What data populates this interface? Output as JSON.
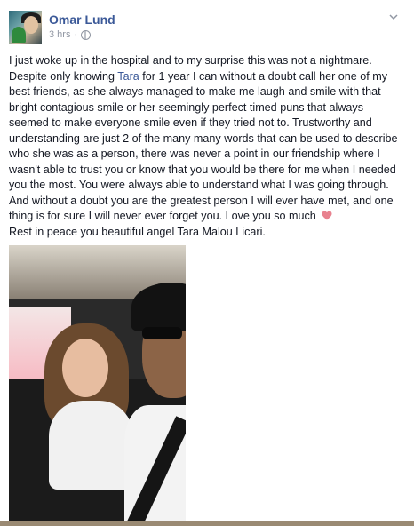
{
  "post": {
    "author_name": "Omar Lund",
    "timestamp": "3 hrs",
    "separator": "·",
    "body_before_link": "I just woke up in the hospital and to my surprise this was not a nightmare. Despite only knowing ",
    "tagged_name": "Tara",
    "body_after_link": " for 1 year I can without a doubt call her one of my best friends, as she always managed to make me laugh and smile with that bright contagious smile or her seemingly perfect timed puns that always seemed to make everyone smile even if they tried not to. Trustworthy and understanding are just 2 of the many many words that can be used to describe who she was as a person, there was never a point in our friendship where I wasn't able to trust you or know that you would be there for me when I needed you the most. You were always able to understand what I was going through. And without a doubt you are the greatest person I will ever have met, and one thing is for sure I will never ever forget you. Love you so much",
    "body_closing": "Rest in peace you beautiful angel Tara Malou Licari.",
    "icons": [
      "globe-icon",
      "chevron-down-icon",
      "heart-icon"
    ]
  },
  "colors": {
    "link": "#3b5998",
    "meta": "#9197a3",
    "heart": "#e8828f"
  }
}
